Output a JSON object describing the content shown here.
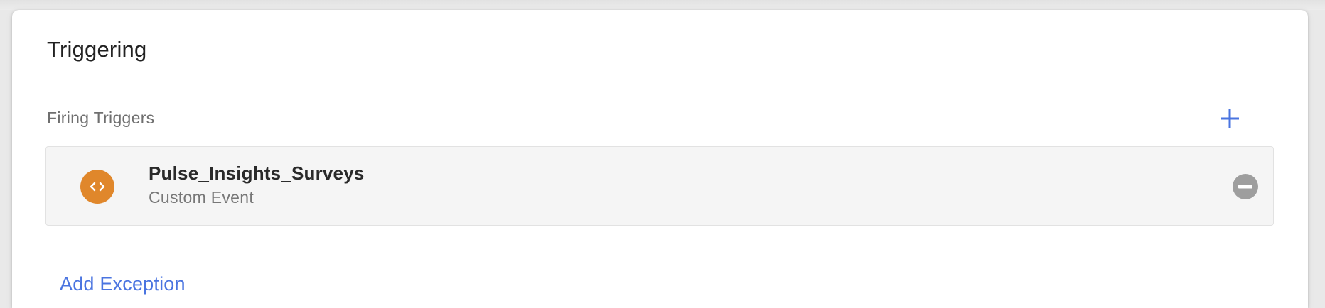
{
  "section": {
    "title": "Triggering"
  },
  "firing_triggers": {
    "label": "Firing Triggers",
    "add_icon": "plus-icon",
    "items": [
      {
        "name": "Pulse_Insights_Surveys",
        "type": "Custom Event",
        "icon": "custom-event-code-icon",
        "icon_color": "#e0872b",
        "remove_icon": "remove-circle-icon"
      }
    ]
  },
  "exceptions": {
    "add_label": "Add Exception"
  },
  "colors": {
    "accent": "#4a74e0",
    "trigger_icon": "#e0872b",
    "remove_icon": "#9e9e9e"
  }
}
